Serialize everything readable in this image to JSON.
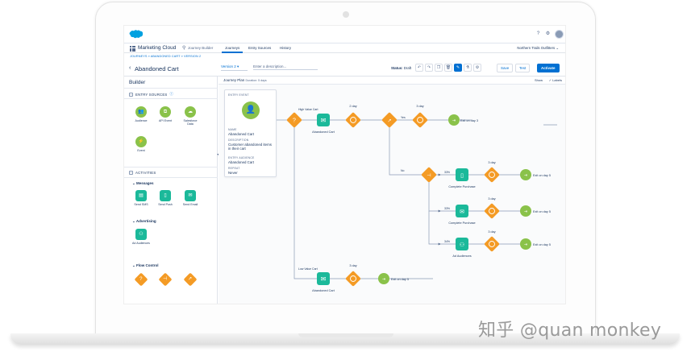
{
  "nav": {
    "app_name": "Marketing Cloud",
    "sub_name": "Journey Builder",
    "tabs": [
      {
        "label": "Journeys",
        "active": true
      },
      {
        "label": "Entry Sources",
        "active": false
      },
      {
        "label": "History",
        "active": false
      }
    ],
    "org": "Northern Trails Outfitters",
    "icons": [
      "help-icon",
      "settings-icon",
      "avatar"
    ]
  },
  "breadcrumb": "JOURNEYS » ABANDONED CART » VERSION 2",
  "header": {
    "title": "Abandoned Cart",
    "version": "Version 2",
    "description_placeholder": "Enter a description...",
    "status_label": "Status:",
    "status_value": "Draft",
    "tools": [
      "undo-icon",
      "redo-icon",
      "copy-icon",
      "delete-icon",
      "draw-icon",
      "test-icon",
      "settings-icon"
    ],
    "save": "Save",
    "test": "Test",
    "activate": "Activate"
  },
  "sidebar": {
    "title": "Builder",
    "entry_sources": {
      "heading": "ENTRY SOURCES",
      "items": [
        {
          "label": "Audience",
          "icon": "audience-icon"
        },
        {
          "label": "API Event",
          "icon": "api-event-icon"
        },
        {
          "label": "Salesforce Data",
          "icon": "salesforce-data-icon"
        },
        {
          "label": "Event",
          "icon": "event-icon"
        }
      ]
    },
    "activities": {
      "heading": "ACTIVITIES",
      "messages": {
        "heading": "Messages",
        "items": [
          {
            "label": "Send SMS",
            "icon": "sms-icon"
          },
          {
            "label": "Send Push",
            "icon": "push-icon"
          },
          {
            "label": "Send Email",
            "icon": "email-icon"
          }
        ]
      },
      "advertising": {
        "heading": "Advertising",
        "items": [
          {
            "label": "Ad Audiences",
            "icon": "ad-audiences-icon"
          }
        ]
      },
      "flow_control": {
        "heading": "Flow Control",
        "items": [
          {
            "label": "",
            "icon": "decision-split-icon"
          },
          {
            "label": "",
            "icon": "random-split-icon"
          },
          {
            "label": "",
            "icon": "engagement-split-icon"
          }
        ]
      }
    }
  },
  "canvas": {
    "plan_title": "Journey Plan",
    "duration": "Duration: 5 days",
    "show": "Show",
    "labels": "Labels",
    "entry_event": {
      "caption": "ENTRY EVENT",
      "name_caption": "NAME",
      "name": "Abandoned Cart",
      "description_caption": "DESCRIPTION",
      "description": "Customer abandoned items in their cart",
      "entry_audience_caption": "ENTRY AUDIENCE",
      "entry_audience": "Abandoned Cart",
      "repeat_caption": "REPEAT",
      "repeat": "Never"
    },
    "flow": {
      "high_value": "High Value Cart",
      "low_value": "Low Value Cart",
      "abandoned_cart_1": "Abandoned Cart",
      "abandoned_cart_2": "Abandoned Cart",
      "wait_2day_top": "2 day",
      "wait_3day_top": "3 day",
      "yes": "Yes",
      "no": "No",
      "exit_day_3": "Exit on day 3",
      "exit_day_5_a": "Exit on day 5",
      "exit_day_5_b": "Exit on day 5",
      "exit_day_5_c": "Exit on day 5",
      "exit_day_5_low": "Exit on day 5",
      "pct_33_a": "33%",
      "pct_33_b": "33%",
      "pct_34": "34%",
      "complete_purchase_1": "Complete Purchase",
      "complete_purchase_2": "Complete Purchase",
      "ad_audiences": "Ad Audiences",
      "wait_3day_a": "3 day",
      "wait_3day_b": "3 day",
      "wait_3day_c": "3 day",
      "wait_3day_low": "3 day"
    }
  },
  "watermark": "知乎 @quan monkey",
  "colors": {
    "accent": "#0070d2",
    "decision": "#f49b25",
    "message": "#1bb99a",
    "exit": "#8ac24a"
  }
}
